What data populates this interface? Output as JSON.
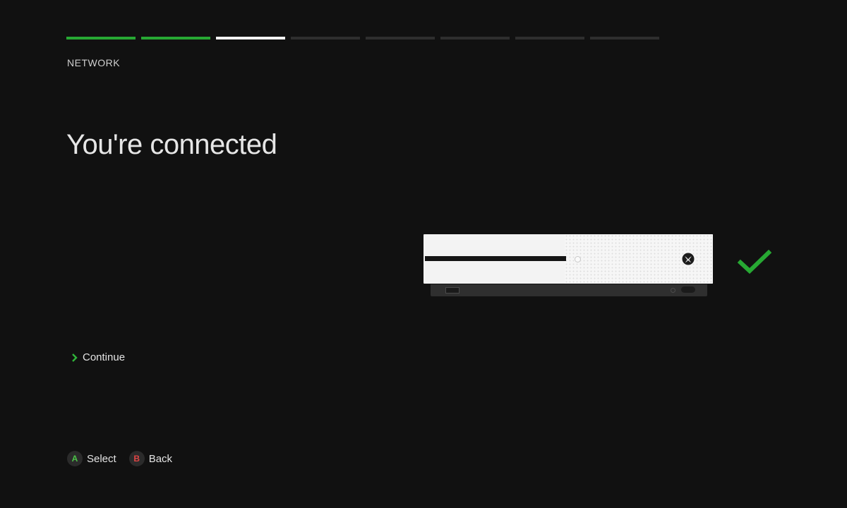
{
  "progress": {
    "total_steps": 8,
    "completed_steps": 2,
    "current_step": 3,
    "colors": {
      "done": "#27a833",
      "current": "#f2f2f2",
      "pending": "#2e2e2e"
    }
  },
  "header": {
    "section_label": "NETWORK"
  },
  "main": {
    "title": "You're connected",
    "status_icon": "checkmark-icon",
    "status_color": "#27a833",
    "console_image": "xbox-one-s-console"
  },
  "options": [
    {
      "label": "Continue",
      "icon": "chevron-right-icon",
      "selected": true
    }
  ],
  "footer": {
    "hints": [
      {
        "button": "A",
        "label": "Select",
        "color": "#4cc348"
      },
      {
        "button": "B",
        "label": "Back",
        "color": "#e04545"
      }
    ]
  }
}
